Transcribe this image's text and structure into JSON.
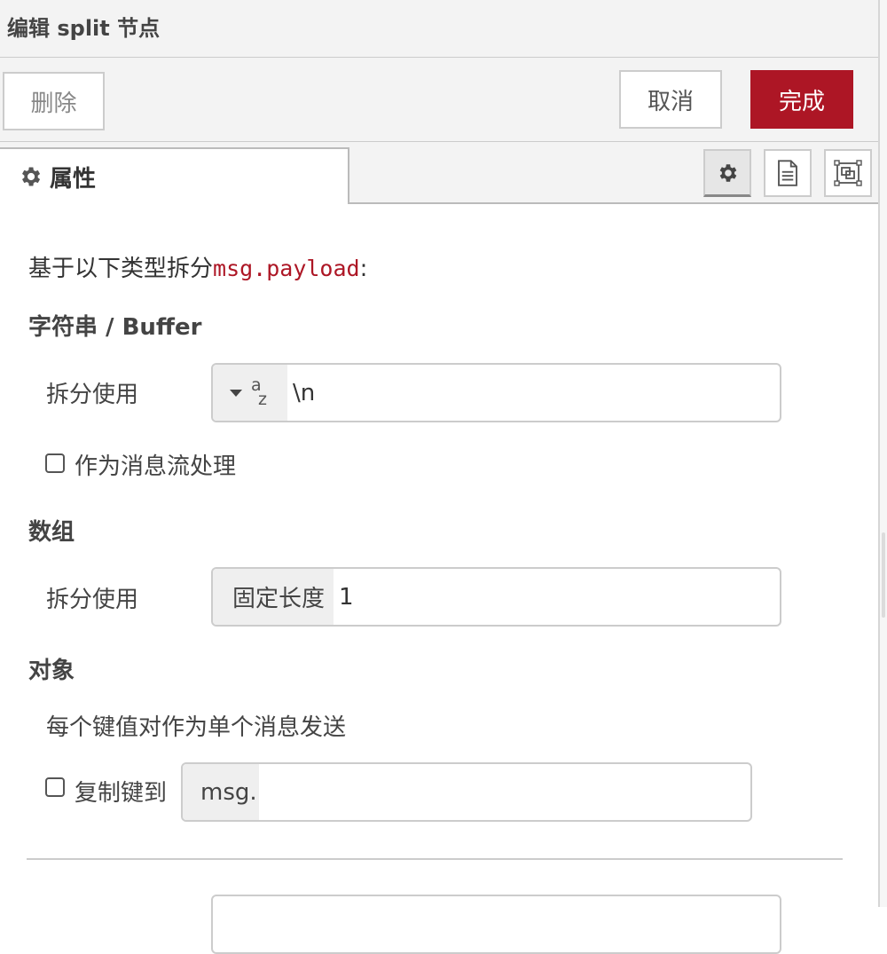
{
  "header": {
    "title": "编辑 split 节点"
  },
  "toolbar": {
    "delete_label": "删除",
    "cancel_label": "取消",
    "done_label": "完成"
  },
  "tabs": {
    "properties_label": "属性"
  },
  "icons": {
    "tab": "gear-icon",
    "buttons": [
      "gear-icon",
      "document-icon",
      "layout-icon"
    ]
  },
  "colors": {
    "accent": "#ad1625",
    "code": "#ad1625"
  },
  "form": {
    "description_prefix": "基于以下类型拆分",
    "description_code": "msg.payload",
    "description_suffix": ":",
    "string_section": {
      "title": "字符串 / Buffer",
      "split_label": "拆分使用",
      "split_type_glyph_a": "a",
      "split_type_glyph_z": "z",
      "split_value": "\\n",
      "stream_label": "作为消息流处理",
      "stream_checked": false
    },
    "array_section": {
      "title": "数组",
      "split_label": "拆分使用",
      "split_type": "固定长度",
      "split_value": "1"
    },
    "object_section": {
      "title": "对象",
      "description": "每个键值对作为单个消息发送",
      "copy_key_label": "复制键到",
      "copy_key_checked": false,
      "copy_key_prefix": "msg.",
      "copy_key_value": ""
    }
  }
}
